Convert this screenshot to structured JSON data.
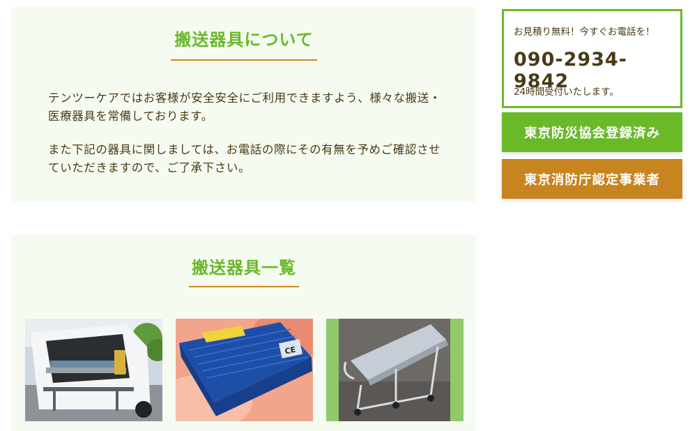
{
  "about": {
    "title": "搬送器具について",
    "paragraph1": "テンツーケアではお客様が安全安全にご利用できますよう、様々な搬送・医療器具を常備しております。",
    "paragraph2": "また下記の器具に関しましては、お電話の際にその有無を予めご確認させていただきますので、ご了承下さい。"
  },
  "equipment": {
    "title": "搬送器具一覧",
    "photos": [
      {
        "icon": "ambulance-stretcher-photo"
      },
      {
        "icon": "power-inverter-photo",
        "label_text": "CE"
      },
      {
        "icon": "stretcher-cart-photo"
      }
    ]
  },
  "contact": {
    "lead": "お見積り無料！今すぐお電話を！",
    "phone": "090-2934-9842",
    "hours": "24時間受付いたします。"
  },
  "badges": {
    "bousai": "東京防災協会登録済み",
    "shoubou": "東京消防庁認定事業者"
  },
  "colors": {
    "accent_green": "#6ab929",
    "accent_orange": "#c8841e",
    "text_brown": "#4a3a14",
    "card_bg": "#f5fbf1"
  }
}
